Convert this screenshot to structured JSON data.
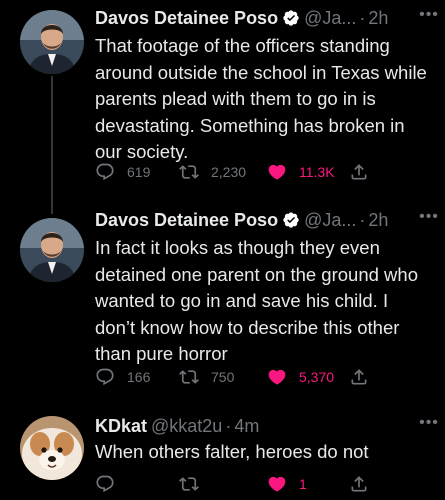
{
  "tweets": [
    {
      "name": "Davos Detainee Poso",
      "handle": "@Ja...",
      "separator": "·",
      "time": "2h",
      "text": "That footage of the officers standing around outside the school in Texas while parents plead with them to go in is devastating. Something has broken in our society.",
      "replies": "619",
      "retweets": "2,230",
      "likes": "11.3K",
      "verified": true,
      "liked": true
    },
    {
      "name": "Davos Detainee Poso",
      "handle": "@Ja...",
      "separator": "·",
      "time": "2h",
      "text": "In fact it looks as though they even detained one parent on the ground who wanted to go in and save his child. I don’t know how to describe this other than pure horror",
      "replies": "166",
      "retweets": "750",
      "likes": "5,370",
      "verified": true,
      "liked": true
    },
    {
      "name": "KDkat",
      "handle": "@kkat2u",
      "separator": "·",
      "time": "4m",
      "text": "When others falter, heroes do not",
      "replies": "",
      "retweets": "",
      "likes": "1",
      "verified": false,
      "liked": true
    }
  ],
  "more_glyph": "•••",
  "colors": {
    "background": "#000000",
    "text": "#e7e9ea",
    "muted": "#71767b",
    "like": "#f91880",
    "verified": "#1d9bf0",
    "thread_line": "#333639"
  }
}
